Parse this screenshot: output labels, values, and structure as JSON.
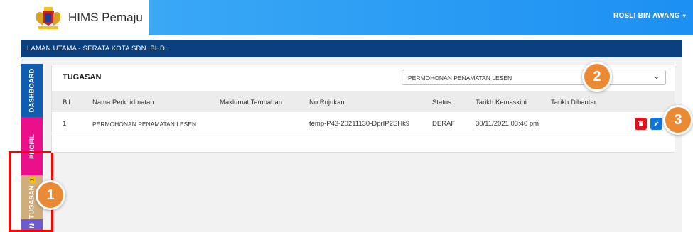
{
  "app": {
    "title": "HIMS Pemaju"
  },
  "user": {
    "name": "ROSLI BIN AWANG"
  },
  "breadcrumb": "LAMAN UTAMA - SERATA KOTA SDN. BHD.",
  "sidebar": {
    "items": [
      {
        "label": "DASHBOARD",
        "color": "#0f5db0"
      },
      {
        "label": "PROFIL",
        "color": "#ec0f8c"
      },
      {
        "label": "TUGASAN",
        "badge": "1",
        "color": "#d2ad7c"
      },
      {
        "label": "N",
        "color": "#6c5ccf"
      }
    ]
  },
  "card": {
    "title": "TUGASAN",
    "filter": {
      "selected": "PERMOHONAN PENAMATAN LESEN"
    }
  },
  "table": {
    "headers": [
      "Bil",
      "Nama Perkhidmatan",
      "Maklumat Tambahan",
      "No Rujukan",
      "Status",
      "Tarikh Kemaskini",
      "Tarikh Dihantar"
    ],
    "rows": [
      {
        "bil": "1",
        "nama": "PERMOHONAN PENAMATAN LESEN",
        "maklumat": "",
        "rujukan": "temp-P43-20211130-DprIP2SHk9",
        "status": "DERAF",
        "kemaskini": "30/11/2021 03:40 pm",
        "dihantar": ""
      }
    ]
  },
  "annotations": [
    "1",
    "2",
    "3"
  ],
  "colors": {
    "accent": "#1c90f3",
    "breadcrumb": "#0b3f7e",
    "annotation": "#ea8a35",
    "highlight": "#ff0000"
  }
}
